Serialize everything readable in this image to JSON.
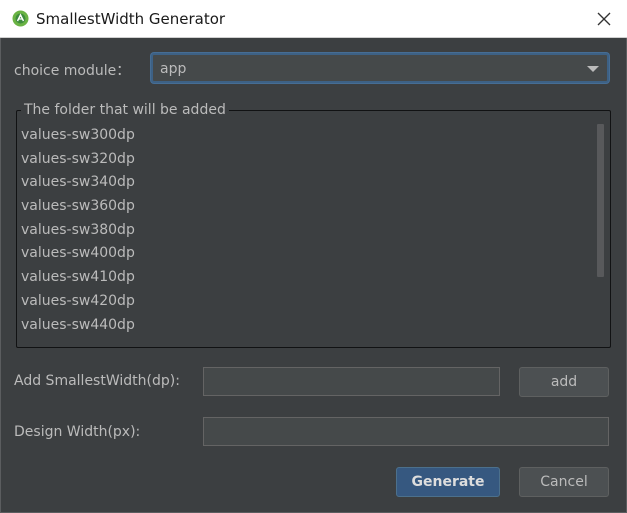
{
  "window": {
    "title": "SmallestWidth Generator",
    "app_icon": "android-studio-icon",
    "close_icon": "close-icon"
  },
  "module": {
    "label": "choice module：",
    "selected": "app"
  },
  "folders": {
    "legend": "The folder that will be added",
    "items": [
      "values-sw300dp",
      "values-sw320dp",
      "values-sw340dp",
      "values-sw360dp",
      "values-sw380dp",
      "values-sw400dp",
      "values-sw410dp",
      "values-sw420dp",
      "values-sw440dp"
    ],
    "scroll_fraction_visible": 0.69
  },
  "add_width": {
    "label": "Add SmallestWidth(dp):",
    "value": "",
    "button": "add"
  },
  "design_width": {
    "label": "Design Width(px):",
    "value": ""
  },
  "footer": {
    "generate": "Generate",
    "cancel": "Cancel"
  },
  "colors": {
    "background": "#3c3f41",
    "text": "#bbbbbb",
    "primary_button": "#365880",
    "focus_border": "#3d6185"
  }
}
